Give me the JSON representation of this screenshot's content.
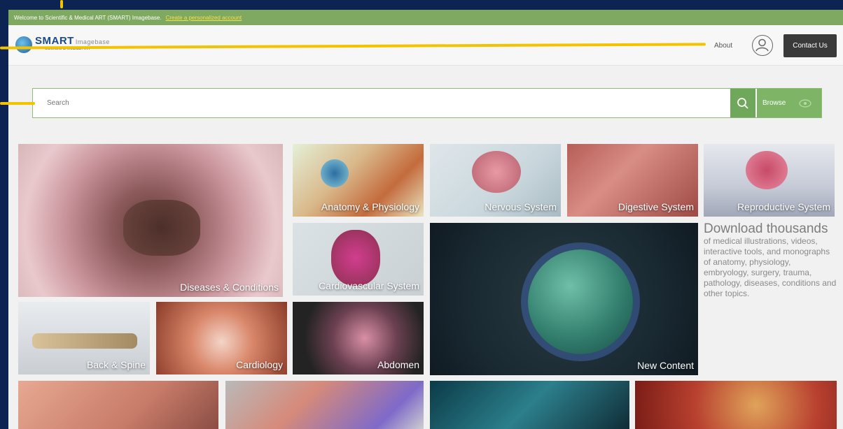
{
  "welcome": {
    "text": "Welcome to Scientific & Medical ART (SMART) Imagebase.",
    "link": "Create a personalized account"
  },
  "logo": {
    "main": "SMART",
    "sub": "Imagebase",
    "tagline": "Scientific & Medical ART"
  },
  "nav": {
    "about": "About",
    "contact": "Contact Us"
  },
  "search": {
    "placeholder": "Search",
    "browse": "Browse"
  },
  "tiles": [
    {
      "label": "Diseases & Conditions"
    },
    {
      "label": "Anatomy & Physiology"
    },
    {
      "label": "Nervous System"
    },
    {
      "label": "Digestive System"
    },
    {
      "label": "Reproductive System"
    },
    {
      "label": "Cardiovascular System"
    },
    {
      "label": "Back & Spine"
    },
    {
      "label": "Cardiology"
    },
    {
      "label": "Abdomen"
    },
    {
      "label": "New Content"
    }
  ],
  "promo": {
    "title": "Download thousands",
    "body": "of medical illustrations, videos, interactive tools, and monographs of anatomy, physiology, embryology, surgery, trauma, pathology, diseases, conditions and other topics."
  },
  "colors": {
    "accent": "#7fa861",
    "highlight": "#f3c300",
    "background": "#0d2452"
  }
}
